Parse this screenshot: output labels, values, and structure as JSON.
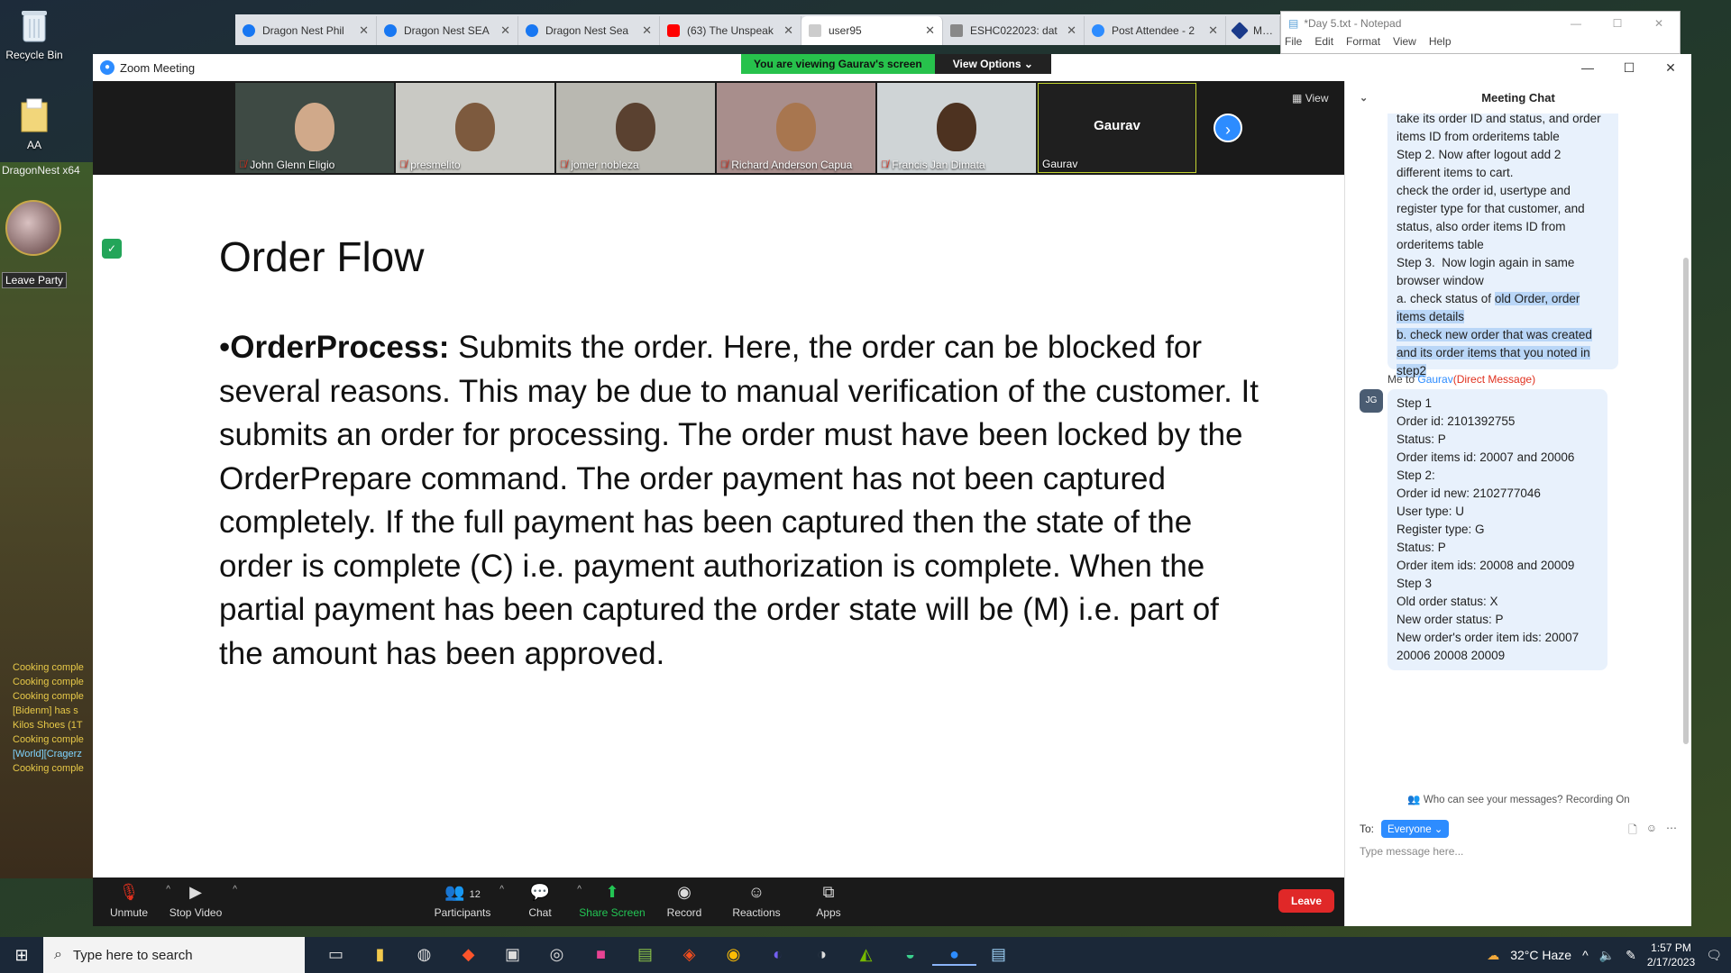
{
  "desktop": {
    "icons": [
      {
        "label": "Recycle Bin"
      },
      {
        "label": "AA"
      }
    ]
  },
  "game": {
    "title": "DragonNest x64",
    "leave_party": "Leave Party",
    "log": [
      "Cooking comple",
      "Cooking comple",
      "Cooking comple",
      "[Bidenm] has s",
      "Kilos Shoes (1T",
      "Cooking comple",
      "[World][Cragerz",
      "Cooking comple"
    ]
  },
  "browser": {
    "tabs": [
      {
        "label": "Dragon Nest Phil",
        "color": "#1877f2"
      },
      {
        "label": "Dragon Nest SEA",
        "color": "#1877f2"
      },
      {
        "label": "Dragon Nest Sea",
        "color": "#1877f2"
      },
      {
        "label": "(63) The Unspeak",
        "color": "#ff0000"
      },
      {
        "label": "user95",
        "color": "#cccccc",
        "active": true
      },
      {
        "label": "ESHC022023: dat",
        "color": "#888888"
      },
      {
        "label": "Post Attendee - 2",
        "color": "#2d8cff"
      },
      {
        "label": "MEM",
        "color": "#1a3a8a"
      }
    ]
  },
  "notepad": {
    "title": "*Day 5.txt - Notepad",
    "menu": [
      "File",
      "Edit",
      "Format",
      "View",
      "Help"
    ]
  },
  "zoom": {
    "window_title": "Zoom Meeting",
    "viewing_banner": "You are viewing Gaurav's screen",
    "view_options": "View Options",
    "view_label": "View",
    "participants": [
      {
        "name": "John Glenn Eligio"
      },
      {
        "name": "presmelito"
      },
      {
        "name": "jomer nobleza"
      },
      {
        "name": "Richard Anderson Capua"
      },
      {
        "name": "Francis Jan Dimata"
      }
    ],
    "sharer_name": "Gaurav",
    "sharer_label": "Gaurav",
    "slide": {
      "title": "Order Flow",
      "bullet_term": "OrderProcess:",
      "bullet_text": " Submits the order. Here, the order can be blocked for several reasons.  This may be due to manual verification of the customer. It submits an order for processing. The order must have been locked by the OrderPrepare command. The order payment has not been captured completely. If the full payment has been captured then the state of the order is complete (C) i.e. payment authorization is complete. When the partial payment has been captured the order state will be (M) i.e. part of the amount has been approved."
    },
    "controls": {
      "unmute": "Unmute",
      "stop_video": "Stop Video",
      "participants": "Participants",
      "participant_count": "12",
      "chat": "Chat",
      "share_screen": "Share Screen",
      "record": "Record",
      "reactions": "Reactions",
      "apps": "Apps",
      "leave": "Leave"
    },
    "chat": {
      "title": "Meeting Chat",
      "msg1_lines": [
        "take its order ID and status, and order",
        "items ID from orderitems table",
        "",
        "Step 2. Now after logout add 2",
        "different items to cart.",
        "check the order id, usertype and",
        "register type for that customer, and",
        "status, also order items ID from",
        "orderitems table",
        "",
        "Step 3.  Now login again in same",
        "browser window"
      ],
      "msg1_a_prefix": "a. check status of ",
      "msg1_a_hl": "old Order, order",
      "msg1_hl_lines": [
        "items details",
        "b. check new order that was created",
        "and its order items that you noted in",
        "step2"
      ],
      "me_to": "Me to ",
      "to_name": "Gaurav",
      "dm": "(Direct Message)",
      "avatar_initials": "JG",
      "msg2_lines": [
        "Step 1",
        "Order id: 2101392755",
        "Status: P",
        "Order items id: 20007 and 20006",
        "",
        "Step 2:",
        "Order id new: 2102777046",
        "User type: U",
        "Register type: G",
        "Status: P",
        "Order item ids: 20008 and 20009",
        "",
        "Step 3",
        "Old order status: X",
        "New order status: P",
        "New order's order item ids: 20007",
        "20006 20008 20009"
      ],
      "who_see": "Who can see your messages? Recording On",
      "to_label": "To:",
      "to_select": "Everyone",
      "input_placeholder": "Type message here..."
    }
  },
  "taskbar": {
    "search_placeholder": "Type here to search",
    "weather": "32°C  Haze",
    "time": "1:57 PM",
    "date": "2/17/2023"
  }
}
